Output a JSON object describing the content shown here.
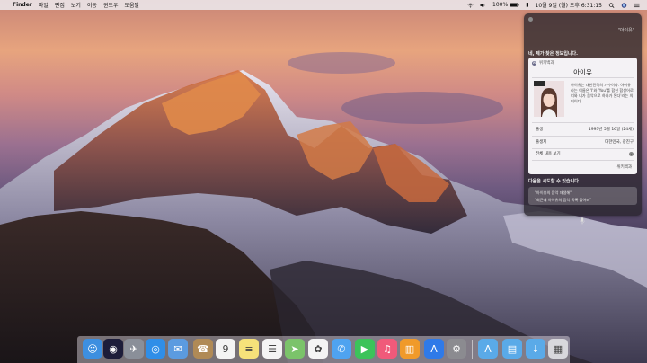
{
  "menubar": {
    "apple_symbol": "",
    "app_name": "Finder",
    "menus": [
      "파일",
      "편집",
      "보기",
      "이동",
      "윈도우",
      "도움말"
    ],
    "battery": "100%",
    "datetime": "10월 9일 (월) 오후 6:31:15"
  },
  "siri": {
    "query": "\"아이유\"",
    "found_text": "네, 제가 찾은 정보입니다.",
    "card": {
      "source": "위키백과",
      "source_icon": "W",
      "name": "아이유",
      "description": "아이유는 대한민국의 가수이다. 아이유라는 이름은 'I'와 'You'를 합친 합성어로 너와 내가 음악으로 하나가 된다'라는 의미이다.",
      "rows": [
        {
          "label": "출생",
          "value": "1993년 5월 16일 (24세)"
        },
        {
          "label": "출생지",
          "value": "대한민국, 광진구"
        }
      ],
      "see_all": "전체 내용 보기",
      "footer": "위키백과"
    },
    "suggest_title": "다음을 시도할 수 있습니다.",
    "suggestions": [
      "\"아이유의 음악 재생해\"",
      "\"최근에 아이유의 음악 목록 틀어봐\""
    ]
  },
  "dock": {
    "items": [
      {
        "name": "finder",
        "color": "#3d8fe0",
        "glyph": "☺"
      },
      {
        "name": "siri",
        "color": "#1d1d3a",
        "glyph": "◉"
      },
      {
        "name": "launchpad",
        "color": "#8a8f99",
        "glyph": "✈"
      },
      {
        "name": "safari",
        "color": "#2f8ee8",
        "glyph": "◎"
      },
      {
        "name": "mail",
        "color": "#5b9be0",
        "glyph": "✉"
      },
      {
        "name": "contacts",
        "color": "#b08a56",
        "glyph": "☎"
      },
      {
        "name": "calendar",
        "color": "#f4f4f4",
        "glyph": "9"
      },
      {
        "name": "notes",
        "color": "#f6e27a",
        "glyph": "≡"
      },
      {
        "name": "reminders",
        "color": "#f4f4f4",
        "glyph": "☰"
      },
      {
        "name": "maps",
        "color": "#7bc36a",
        "glyph": "➤"
      },
      {
        "name": "photos",
        "color": "#f4f4f4",
        "glyph": "✿"
      },
      {
        "name": "messages",
        "color": "#4fa3f0",
        "glyph": "✆"
      },
      {
        "name": "facetime",
        "color": "#3cc35a",
        "glyph": "▶"
      },
      {
        "name": "itunes",
        "color": "#f05a7a",
        "glyph": "♫"
      },
      {
        "name": "ibooks",
        "color": "#f09a2a",
        "glyph": "▥"
      },
      {
        "name": "app-store",
        "color": "#2f7ae8",
        "glyph": "A"
      },
      {
        "name": "system-preferences",
        "color": "#8b8b90",
        "glyph": "⚙"
      },
      {
        "name": "applications-folder",
        "color": "#5aaae8",
        "glyph": "A"
      },
      {
        "name": "documents-folder",
        "color": "#5aaae8",
        "glyph": "▤"
      },
      {
        "name": "downloads-folder",
        "color": "#5aaae8",
        "glyph": "↓"
      },
      {
        "name": "trash",
        "color": "#d8d8dc",
        "glyph": "▦"
      }
    ]
  },
  "colors": {
    "menubar": "#ece8ec",
    "siri_panel": "#28242c",
    "card": "#f4f2f5"
  }
}
